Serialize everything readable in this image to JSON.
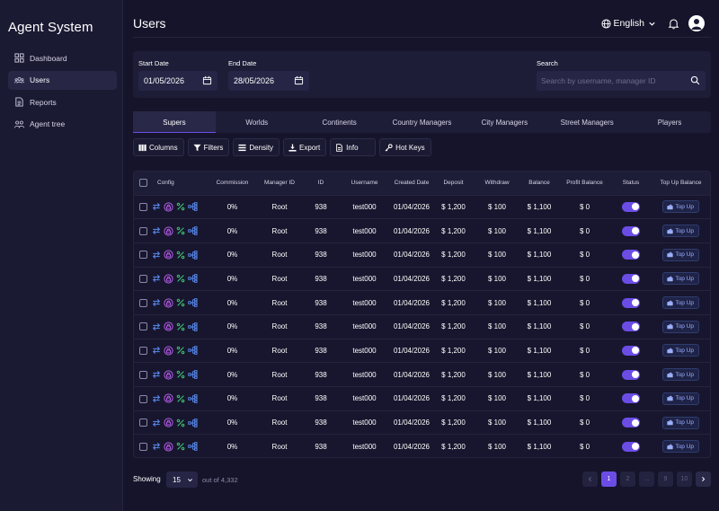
{
  "app": {
    "brand": "Agent System",
    "page_title": "Users"
  },
  "sidebar": {
    "items": [
      {
        "label": "Dashboard",
        "icon": "grid-icon",
        "active": false
      },
      {
        "label": "Users",
        "icon": "users-icon",
        "active": true
      },
      {
        "label": "Reports",
        "icon": "document-icon",
        "active": false
      },
      {
        "label": "Agent tree",
        "icon": "team-icon",
        "active": false
      }
    ]
  },
  "header": {
    "language": "English"
  },
  "filters": {
    "start_label": "Start Date",
    "start_value": "01/05/2026",
    "end_label": "End Date",
    "end_value": "28/05/2026",
    "search_label": "Search",
    "search_placeholder": "Search by username, manager ID"
  },
  "tabs": [
    "Supers",
    "Worlds",
    "Continents",
    "Country Managers",
    "City Managers",
    "Street Managers",
    "Players"
  ],
  "active_tab": 0,
  "toolbar": {
    "columns": "Columns",
    "filters": "Filters",
    "density": "Density",
    "export": "Export",
    "info": "Info",
    "hotkeys": "Hot Keys"
  },
  "table": {
    "headers": [
      "Config",
      "Commission",
      "Manager ID",
      "ID",
      "Username",
      "Created Date",
      "Deposit",
      "Withdraw",
      "Balance",
      "Profit Balance",
      "Status",
      "Top Up Balance"
    ],
    "topup_label": "Top Up",
    "rows": [
      {
        "commission": "0%",
        "manager_id": "Root",
        "id": "938",
        "username": "test000",
        "created": "01/04/2026",
        "deposit": "$ 1,200",
        "withdraw": "$ 100",
        "balance": "$ 1,100",
        "profit": "$ 0",
        "status": true
      },
      {
        "commission": "0%",
        "manager_id": "Root",
        "id": "938",
        "username": "test000",
        "created": "01/04/2026",
        "deposit": "$ 1,200",
        "withdraw": "$ 100",
        "balance": "$ 1,100",
        "profit": "$ 0",
        "status": true
      },
      {
        "commission": "0%",
        "manager_id": "Root",
        "id": "938",
        "username": "test000",
        "created": "01/04/2026",
        "deposit": "$ 1,200",
        "withdraw": "$ 100",
        "balance": "$ 1,100",
        "profit": "$ 0",
        "status": true
      },
      {
        "commission": "0%",
        "manager_id": "Root",
        "id": "938",
        "username": "test000",
        "created": "01/04/2026",
        "deposit": "$ 1,200",
        "withdraw": "$ 100",
        "balance": "$ 1,100",
        "profit": "$ 0",
        "status": true
      },
      {
        "commission": "0%",
        "manager_id": "Root",
        "id": "938",
        "username": "test000",
        "created": "01/04/2026",
        "deposit": "$ 1,200",
        "withdraw": "$ 100",
        "balance": "$ 1,100",
        "profit": "$ 0",
        "status": true
      },
      {
        "commission": "0%",
        "manager_id": "Root",
        "id": "938",
        "username": "test000",
        "created": "01/04/2026",
        "deposit": "$ 1,200",
        "withdraw": "$ 100",
        "balance": "$ 1,100",
        "profit": "$ 0",
        "status": true
      },
      {
        "commission": "0%",
        "manager_id": "Root",
        "id": "938",
        "username": "test000",
        "created": "01/04/2026",
        "deposit": "$ 1,200",
        "withdraw": "$ 100",
        "balance": "$ 1,100",
        "profit": "$ 0",
        "status": true
      },
      {
        "commission": "0%",
        "manager_id": "Root",
        "id": "938",
        "username": "test000",
        "created": "01/04/2026",
        "deposit": "$ 1,200",
        "withdraw": "$ 100",
        "balance": "$ 1,100",
        "profit": "$ 0",
        "status": true
      },
      {
        "commission": "0%",
        "manager_id": "Root",
        "id": "938",
        "username": "test000",
        "created": "01/04/2026",
        "deposit": "$ 1,200",
        "withdraw": "$ 100",
        "balance": "$ 1,100",
        "profit": "$ 0",
        "status": true
      },
      {
        "commission": "0%",
        "manager_id": "Root",
        "id": "938",
        "username": "test000",
        "created": "01/04/2026",
        "deposit": "$ 1,200",
        "withdraw": "$ 100",
        "balance": "$ 1,100",
        "profit": "$ 0",
        "status": true
      },
      {
        "commission": "0%",
        "manager_id": "Root",
        "id": "938",
        "username": "test000",
        "created": "01/04/2026",
        "deposit": "$ 1,200",
        "withdraw": "$ 100",
        "balance": "$ 1,100",
        "profit": "$ 0",
        "status": true
      }
    ]
  },
  "footer": {
    "showing_label": "Showing",
    "page_size": "15",
    "out_of": "out of 4,332",
    "pages": [
      "1",
      "2",
      "...",
      "9",
      "10"
    ],
    "current_page": "1"
  },
  "colors": {
    "accent": "#6b4de6",
    "background": "#15142b",
    "sidebar": "#1b1a33",
    "panel": "#1e1d38",
    "config_swap": "#5b8cf0",
    "config_lock": "#b65ce8",
    "config_percent": "#3ec46d",
    "config_tree": "#5b8cf0",
    "topup_text": "#9ab0ff"
  }
}
